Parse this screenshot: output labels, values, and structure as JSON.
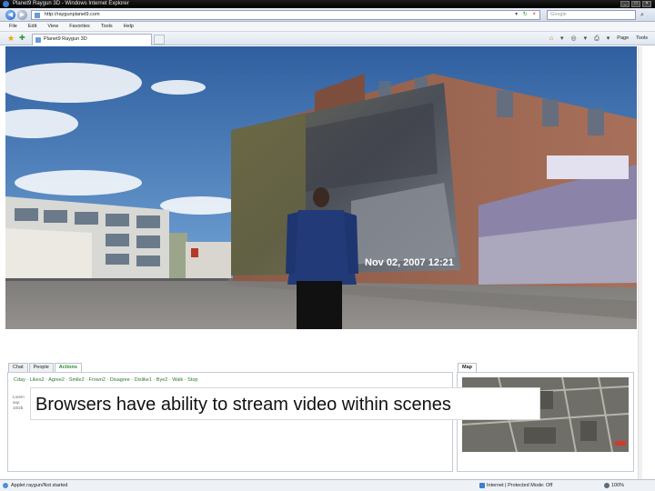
{
  "window": {
    "title": "Planet9 Raygun 3D - Windows Internet Explorer",
    "controls": [
      "_",
      "□",
      "×"
    ]
  },
  "addressbar": {
    "url": "http://raygunplanet9.com",
    "search_placeholder": "Google",
    "tools": [
      "▾",
      "↻",
      "×"
    ],
    "search_go": "⌕"
  },
  "menubar": {
    "items": [
      "File",
      "Edit",
      "View",
      "Favorites",
      "Tools",
      "Help"
    ]
  },
  "tabbar": {
    "tab_title": "Planet9 Raygun 3D",
    "commands": {
      "page": "Page",
      "tools": "Tools"
    },
    "command_icons": [
      "⌂",
      "▾",
      "◎",
      "▾",
      "⎙",
      "▾"
    ]
  },
  "scene": {
    "video_timestamp": "Nov 02, 2007 12:21"
  },
  "panel": {
    "tabs": [
      "Chat",
      "People",
      "Actions"
    ],
    "active_tab": 2,
    "actions_line": "Cday · Likes2 · Agree2 · Smile2 · Frown2 · Disagree · Dislike1 · Bye2 · Walk · Stop",
    "chat_meta": [
      "Lorem",
      "say:",
      "10/2b"
    ],
    "map_tab": "Map"
  },
  "caption": {
    "text": "Browsers have ability to stream video within scenes"
  },
  "statusbar": {
    "text": "Applet raygun/Not started",
    "zone": "Internet | Protected Mode: Off",
    "zoom": "100%"
  }
}
